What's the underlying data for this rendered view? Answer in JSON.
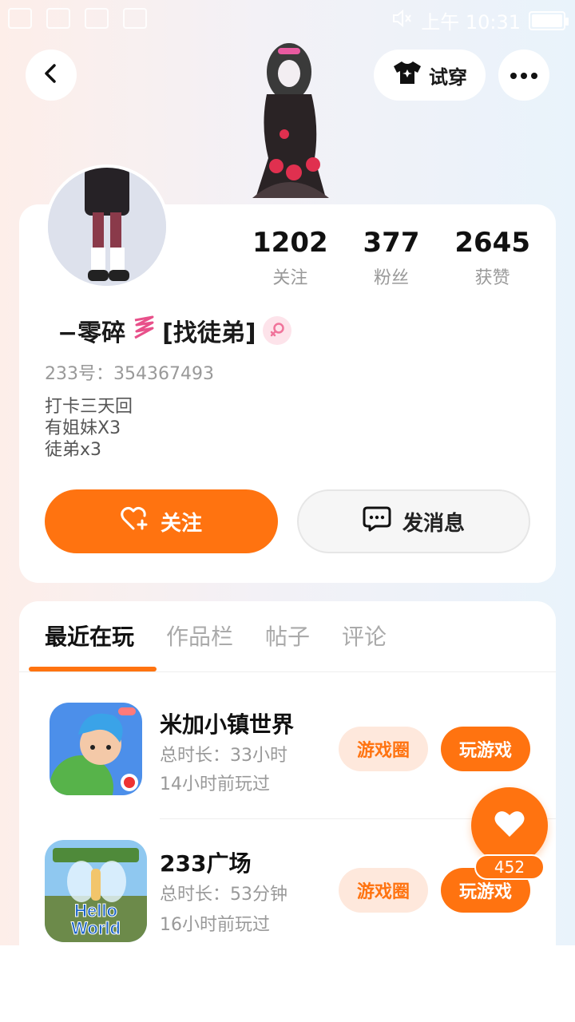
{
  "status_bar": {
    "time": "上午 10:31"
  },
  "header": {
    "try_on_label": "试穿"
  },
  "profile": {
    "stats": [
      {
        "value": "1202",
        "label": "关注"
      },
      {
        "value": "377",
        "label": "粉丝"
      },
      {
        "value": "2645",
        "label": "获赞"
      }
    ],
    "nickname": "−零碎",
    "nickname_suffix": "[找徒弟]",
    "uid": "233号：354367493",
    "bio": [
      "打卡三天回",
      "有姐妹X3",
      "徒弟x3"
    ],
    "follow_label": "关注",
    "message_label": "发消息"
  },
  "tabs": [
    {
      "label": "最近在玩",
      "active": true
    },
    {
      "label": "作品栏",
      "active": false
    },
    {
      "label": "帖子",
      "active": false
    },
    {
      "label": "评论",
      "active": false
    }
  ],
  "games": [
    {
      "name": "米加小镇世界",
      "duration": "总时长：33小时",
      "last_played": "14小时前玩过",
      "circle_label": "游戏圈",
      "play_label": "玩游戏"
    },
    {
      "name": "233广场",
      "duration": "总时长：53分钟",
      "last_played": "16小时前玩过",
      "circle_label": "游戏圈",
      "play_label": "玩游戏",
      "icon_text": [
        "Hello",
        "World"
      ]
    }
  ],
  "like_fab": {
    "count": "452"
  },
  "colors": {
    "accent": "#ff7310",
    "chip_bg": "#fee8dc"
  }
}
